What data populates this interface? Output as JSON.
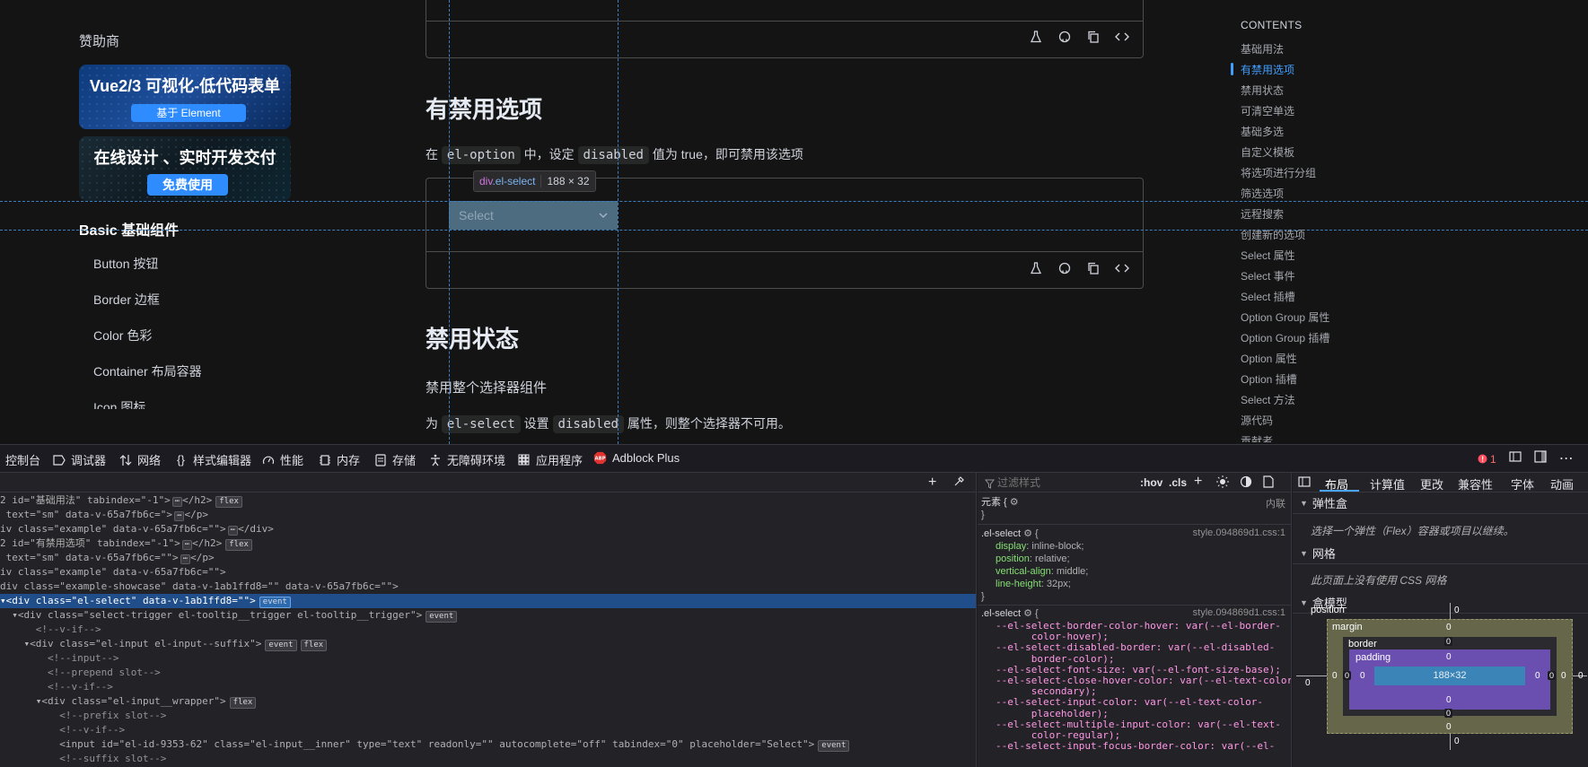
{
  "colors": {
    "accent": "#409eff",
    "selected_row": "#204e8a",
    "error": "#ff6b6b"
  },
  "sidebar": {
    "sponsor_title": "赞助商",
    "banner1": {
      "title": "Vue2/3 可视化-低代码表单",
      "button": "基于 Element"
    },
    "banner2": {
      "title": "在线设计 、实时开发交付",
      "button": "免费使用"
    },
    "section_title": "Basic 基础组件",
    "items": [
      {
        "label": "Button 按钮"
      },
      {
        "label": "Border 边框"
      },
      {
        "label": "Color 色彩"
      },
      {
        "label": "Container 布局容器"
      },
      {
        "label": "Icon 图标"
      }
    ]
  },
  "main": {
    "section1": {
      "heading": "有禁用选项",
      "para_prefix": "在",
      "code1": "el-option",
      "para_mid": "中，设定",
      "code2": "disabled",
      "para_suffix": "值为 true，即可禁用该选项"
    },
    "select_placeholder": "Select",
    "tooltip": {
      "tag": "div",
      "class": ".el-select",
      "size": "188 × 32"
    },
    "section2": {
      "heading": "禁用状态",
      "subtext": "禁用整个选择器组件",
      "para_prefix": "为",
      "code1": "el-select",
      "para_mid": "设置",
      "code2": "disabled",
      "para_suffix": "属性，则整个选择器不可用。"
    },
    "toolbar_icons": [
      "flask-icon",
      "github-icon",
      "copy-icon",
      "code-icon"
    ]
  },
  "toc": {
    "title": "CONTENTS",
    "items": [
      {
        "label": "基础用法"
      },
      {
        "label": "有禁用选项",
        "active": true
      },
      {
        "label": "禁用状态"
      },
      {
        "label": "可清空单选"
      },
      {
        "label": "基础多选"
      },
      {
        "label": "自定义模板"
      },
      {
        "label": "将选项进行分组"
      },
      {
        "label": "筛选选项"
      },
      {
        "label": "远程搜索"
      },
      {
        "label": "创建新的选项"
      },
      {
        "label": "Select 属性"
      },
      {
        "label": "Select 事件"
      },
      {
        "label": "Select 插槽"
      },
      {
        "label": "Option Group 属性"
      },
      {
        "label": "Option Group 插槽"
      },
      {
        "label": "Option 属性"
      },
      {
        "label": "Option 插槽"
      },
      {
        "label": "Select 方法"
      },
      {
        "label": "源代码"
      },
      {
        "label": "贡献者"
      }
    ]
  },
  "devtools": {
    "tabs": {
      "console": "控制台",
      "debugger": "调试器",
      "network": "网络",
      "style_editor": "样式编辑器",
      "performance": "性能",
      "memory": "内存",
      "storage": "存储",
      "accessibility": "无障碍环境",
      "application": "应用程序",
      "adblock": "Adblock Plus"
    },
    "error_count": "1",
    "markup": {
      "lines": [
        {
          "text": "2 id=\"基础用法\" tabindex=\"-1\">",
          "tail": "</h2>",
          "dots": true,
          "badge": "flex"
        },
        {
          "text": " text=\"sm\" data-v-65a7fb6c=\">",
          "tail": "</p>",
          "dots": true
        },
        {
          "text": "iv class=\"example\" data-v-65a7fb6c=\"\">",
          "tail": "</div>",
          "dots": true
        },
        {
          "text": "2 id=\"有禁用选项\" tabindex=\"-1\">",
          "tail": "</h2>",
          "dots": true,
          "badge": "flex"
        },
        {
          "text": " text=\"sm\" data-v-65a7fb6c=\"\">",
          "tail": "</p>",
          "dots": true
        },
        {
          "text": "iv class=\"example\" data-v-65a7fb6c=\"\">"
        },
        {
          "text": "div class=\"example-showcase\" data-v-1ab1ffd8=\"\" data-v-65a7fb6c=\"\">"
        },
        {
          "text": "▾<div class=\"el-select\" data-v-1ab1ffd8=\"\">",
          "badge": "event",
          "selected": true
        },
        {
          "text": "  ▾<div class=\"select-trigger el-tooltip__trigger el-tooltip__trigger\">",
          "badge": "event"
        },
        {
          "text": "      <!--v-if-->"
        },
        {
          "text": "    ▾<div class=\"el-input el-input--suffix\">",
          "badge": "event",
          "badge2": "flex"
        },
        {
          "text": "        <!--input-->"
        },
        {
          "text": "        <!--prepend slot-->"
        },
        {
          "text": "        <!--v-if-->"
        },
        {
          "text": "      ▾<div class=\"el-input__wrapper\">",
          "badge": "flex"
        },
        {
          "text": "          <!--prefix slot-->"
        },
        {
          "text": "          <!--v-if-->"
        },
        {
          "text": "          <input id=\"el-id-9353-62\" class=\"el-input__inner\" type=\"text\" readonly=\"\" autocomplete=\"off\" tabindex=\"0\" placeholder=\"Select\">",
          "badge": "event"
        },
        {
          "text": "          <!--suffix slot-->"
        }
      ]
    },
    "rules": {
      "filter_placeholder": "过滤样式",
      "hov": ":hov",
      "cls": ".cls",
      "element_label": "元素 {",
      "inline_label": "内联",
      "rule1": {
        "selector": ".el-select",
        "source": "style.094869d1.css:1",
        "decls": [
          {
            "prop": "display",
            "value": "inline-block;"
          },
          {
            "prop": "position",
            "value": "relative;"
          },
          {
            "prop": "vertical-align",
            "value": "middle;"
          },
          {
            "prop": "line-height",
            "value": "32px;"
          }
        ]
      },
      "rule2": {
        "selector": ".el-select",
        "source": "style.094869d1.css:1",
        "lines": [
          "--el-select-border-color-hover: var(--el-border-",
          "      color-hover);",
          "--el-select-disabled-border: var(--el-disabled-",
          "      border-color);",
          "--el-select-font-size: var(--el-font-size-base);",
          "--el-select-close-hover-color: var(--el-text-color-",
          "      secondary);",
          "--el-select-input-color: var(--el-text-color-",
          "      placeholder);",
          "--el-select-multiple-input-color: var(--el-text-",
          "      color-regular);",
          "--el-select-input-focus-border-color: var(--el-"
        ]
      }
    },
    "layout": {
      "tabs": [
        "布局",
        "计算值",
        "更改",
        "兼容性",
        "字体",
        "动画"
      ],
      "flex_title": "弹性盒",
      "flex_body": "选择一个弹性（Flex）容器或项目以继续。",
      "grid_title": "网格",
      "grid_body": "此页面上没有使用 CSS 网格",
      "box_title": "盒模型",
      "box": {
        "position_label": "position",
        "margin_label": "margin",
        "border_label": "border",
        "padding_label": "padding",
        "content": "188×32",
        "zero": "0"
      }
    }
  }
}
